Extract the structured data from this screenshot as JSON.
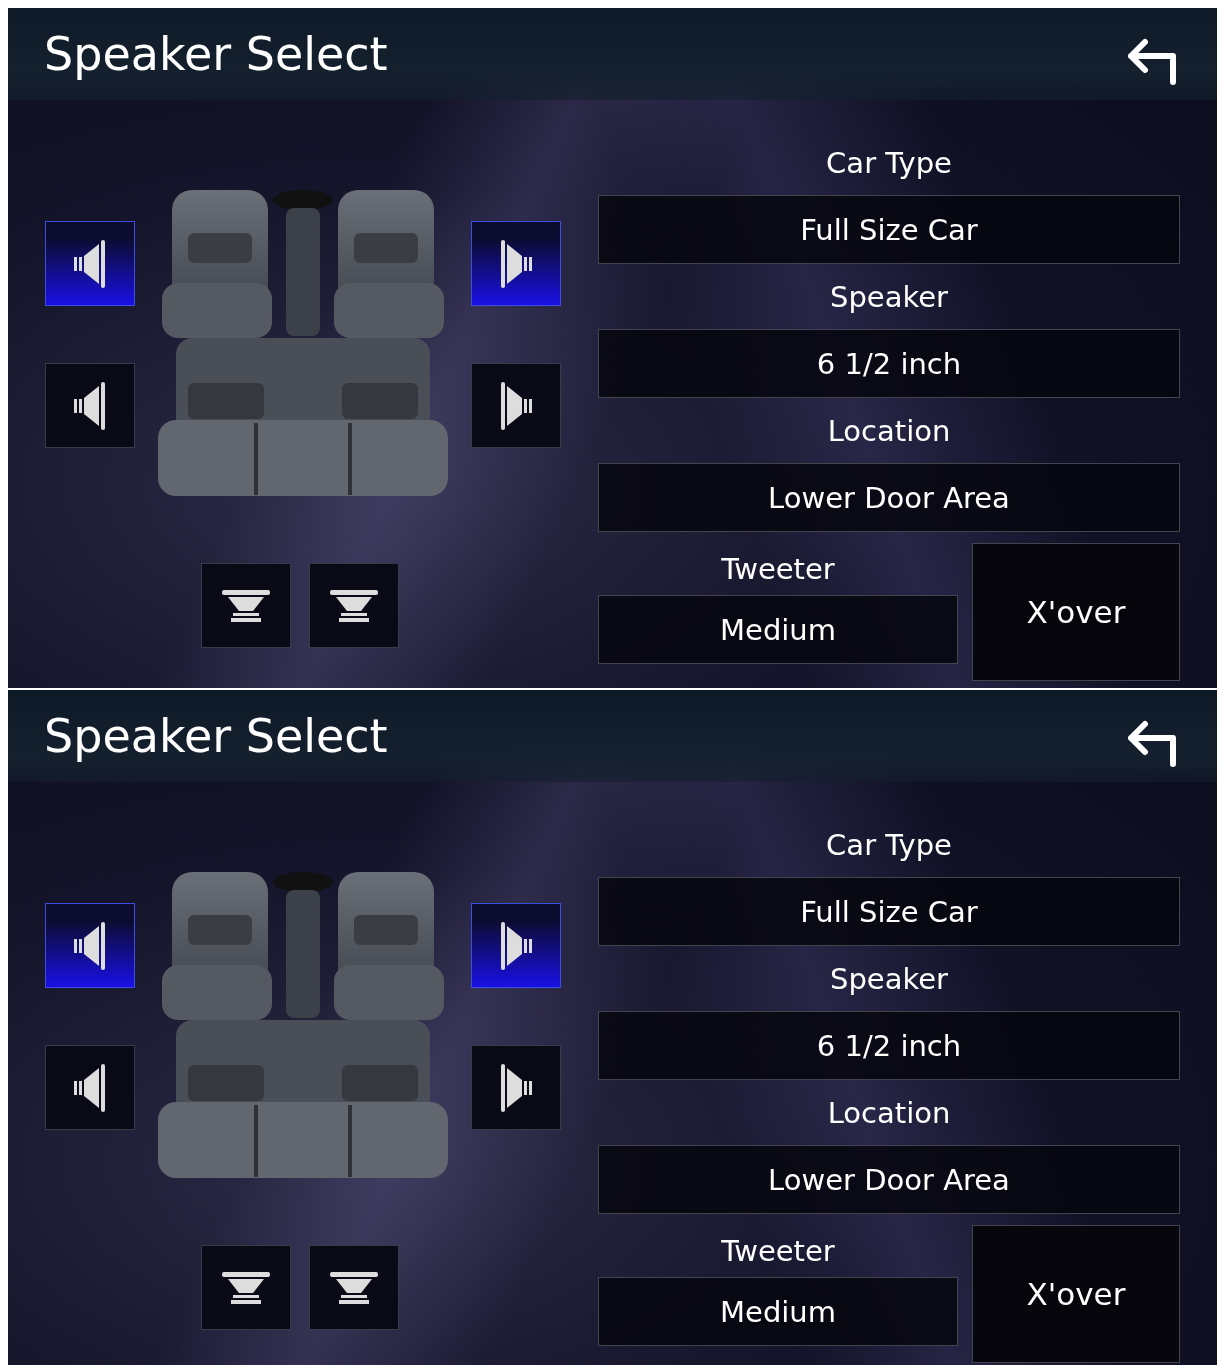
{
  "screens": [
    {
      "title": "Speaker Select",
      "speakers": [
        {
          "kind": "left",
          "selected": true
        },
        {
          "kind": "right",
          "selected": true
        },
        {
          "kind": "left",
          "selected": false
        },
        {
          "kind": "right",
          "selected": false
        }
      ],
      "subwoofers": [
        {
          "selected": false
        },
        {
          "selected": false
        }
      ],
      "settings": [
        {
          "label": "Car Type",
          "value": "Full Size Car"
        },
        {
          "label": "Speaker",
          "value": "6 1/2 inch"
        },
        {
          "label": "Location",
          "value": "Lower Door Area"
        }
      ],
      "tweeter": {
        "label": "Tweeter",
        "value": "Medium"
      },
      "xover_button": "X'over"
    },
    {
      "title": "Speaker Select",
      "speakers": [
        {
          "kind": "left",
          "selected": true
        },
        {
          "kind": "right",
          "selected": true
        },
        {
          "kind": "left",
          "selected": false
        },
        {
          "kind": "right",
          "selected": false
        }
      ],
      "subwoofers": [
        {
          "selected": false
        },
        {
          "selected": false
        }
      ],
      "settings": [
        {
          "label": "Car Type",
          "value": "Full Size Car"
        },
        {
          "label": "Speaker",
          "value": "6 1/2 inch"
        },
        {
          "label": "Location",
          "value": "Lower Door Area"
        }
      ],
      "tweeter": {
        "label": "Tweeter",
        "value": "Medium"
      },
      "xover_button": "X'over"
    }
  ]
}
